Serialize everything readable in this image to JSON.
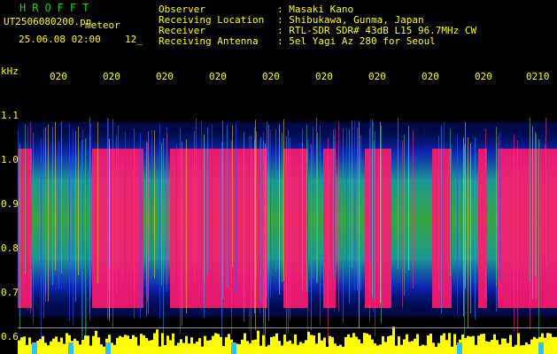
{
  "header": {
    "app_title": "HROFFT",
    "file_name": "UT2506080200.pn",
    "mode": "meteor",
    "datetime": "25.06.08 02:00",
    "count": "12_",
    "rows": [
      {
        "label": "Observer",
        "value": ": Masaki Kano"
      },
      {
        "label": "Receiving Location",
        "value": ": Shibukawa, Gunma, Japan"
      },
      {
        "label": "Receiver",
        "value": ": RTL-SDR SDR# 43dB L15 96.7MHz CW"
      },
      {
        "label": "Receiving Antenna",
        "value": ": 5el Yagi Az 280 for Seoul"
      }
    ]
  },
  "axis": {
    "unit": "kHz",
    "y_ticks": [
      "1.1",
      "1.0",
      "0.9",
      "0.8",
      "0.7",
      "0.6"
    ],
    "time_labels": [
      "020",
      "020",
      "020",
      "020",
      "020",
      "020",
      "020",
      "020",
      "020",
      "0210"
    ]
  },
  "colors": {
    "text": "#ffff00",
    "title": "#20d020",
    "background": "#000000",
    "signal_high": "#ff1a6e",
    "activity": "#ffff00"
  }
}
